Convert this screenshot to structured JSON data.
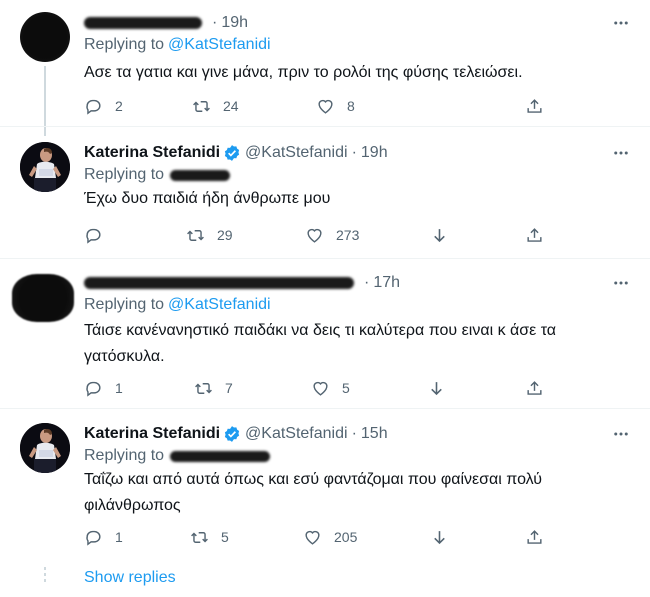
{
  "colors": {
    "link": "#1d9bf0",
    "muted": "#536471",
    "text": "#0f1419",
    "verified": "#1d9bf0"
  },
  "tweets": [
    {
      "display_name": "",
      "handle": "",
      "time": "19h",
      "replying_label": "Replying to",
      "replying_to": "@KatStefanidi",
      "text": "Ασε τα γατια και γινε μάνα, πριν το ρολόι της φύσης τελειώσει.",
      "replies": "2",
      "retweets": "24",
      "likes": "8"
    },
    {
      "display_name": "Katerina Stefanidi",
      "handle": "@KatStefanidi",
      "time": "19h",
      "replying_label": "Replying to",
      "replying_to": "",
      "text": "Έχω δυο παιδιά ήδη άνθρωπε μου",
      "replies": "",
      "retweets": "29",
      "likes": "273"
    },
    {
      "display_name": "",
      "handle": "",
      "time": "17h",
      "replying_label": "Replying to",
      "replying_to": "@KatStefanidi",
      "text": "Τάισε κανέναν⁠ηστικό παιδάκι να δεις τι καλύτερα που ειναι κ άσε τα γατόσκυλα.",
      "replies": "1",
      "retweets": "7",
      "likes": "5"
    },
    {
      "display_name": "Katerina Stefanidi",
      "handle": "@KatStefanidi",
      "time": "15h",
      "replying_label": "Replying to",
      "replying_to": "",
      "text": "Ταΐζω και από αυτά όπως και εσύ φαντάζομαι που φαίνεσαι πολύ φιλάνθρωπος",
      "replies": "1",
      "retweets": "5",
      "likes": "205"
    }
  ],
  "show_replies": "Show replies"
}
